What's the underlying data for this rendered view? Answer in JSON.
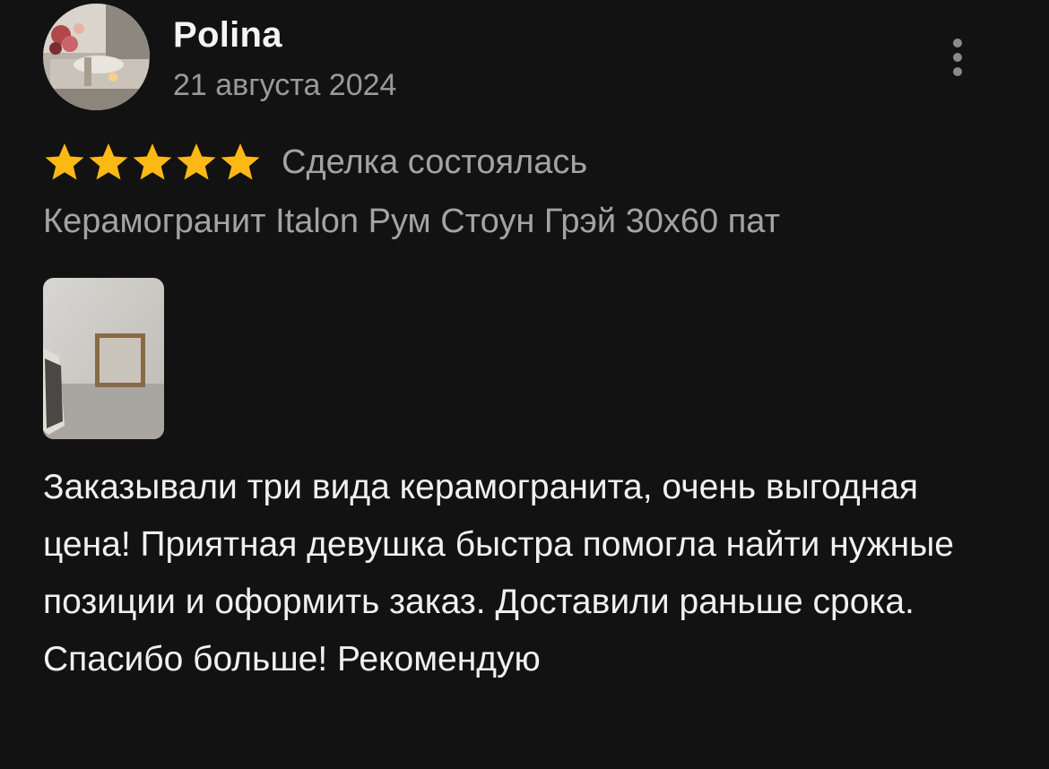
{
  "review": {
    "author": "Polina",
    "date": "21 августа 2024",
    "rating": 5,
    "rating_max": 5,
    "deal_status": "Сделка состоялась",
    "product": "Керамогранит Italon Рум Стоун Грэй 30x60 пат",
    "text": "Заказывали три вида керамогранита, очень выгодная цена! Приятная девушка быстра помогла найти нужные позиции и оформить заказ. Доставили раньше срока. Спасибо больше! Рекомендую",
    "attachments_count": 1
  },
  "icons": {
    "more": "more-vertical-icon",
    "star": "star-icon"
  },
  "colors": {
    "background": "#121212",
    "star": "#fdb913",
    "primary_text": "#f2f2f2",
    "secondary_text": "#9a9a9a"
  }
}
